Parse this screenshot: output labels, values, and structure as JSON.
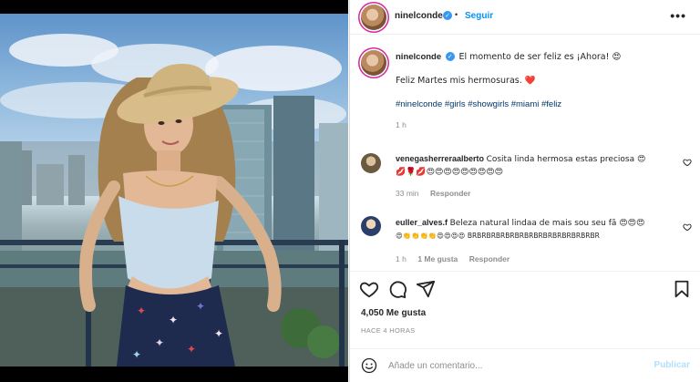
{
  "post": {
    "username": "ninelconde",
    "follow_label": "Seguir",
    "dot": "•",
    "more": "•••"
  },
  "caption": {
    "username": "ninelconde",
    "line1": "El momento de ser feliz es ¡Ahora! 😍",
    "line2": "Feliz Martes mis hermosuras. ❤️",
    "hashtags": "#ninelconde #girls #showgirls #miami #feliz",
    "time": "1 h"
  },
  "comments": [
    {
      "username": "venegasherreraalberto",
      "text": "Cosita linda hermosa estas preciosa 😍",
      "text2": "💋🌹💋😍😍😍😍😍😍😍😍😍",
      "time": "33 min",
      "reply": "Responder"
    },
    {
      "username": "euller_alves.f",
      "text": "Beleza natural lindaa de mais sou seu fã 😍😍😍",
      "text2": "😍👏👏👏👏😍😍😍😍 BRBRBRBRBRBRBRBRBRBRBRBRBRBR",
      "time": "1 h",
      "likes": "1 Me gusta",
      "reply": "Responder"
    }
  ],
  "actions": {
    "likes": "4,050 Me gusta",
    "time": "HACE 4 HORAS"
  },
  "composer": {
    "placeholder": "Añade un comentario...",
    "post_label": "Publicar"
  },
  "colors": {
    "accent": "#0095f6",
    "verified": "#3897f0",
    "hashtag": "#00376b",
    "muted": "#8e8e8e"
  },
  "icons": [
    "heart-icon",
    "comment-icon",
    "share-icon",
    "bookmark-icon",
    "emoji-icon",
    "verified-icon",
    "more-icon"
  ]
}
